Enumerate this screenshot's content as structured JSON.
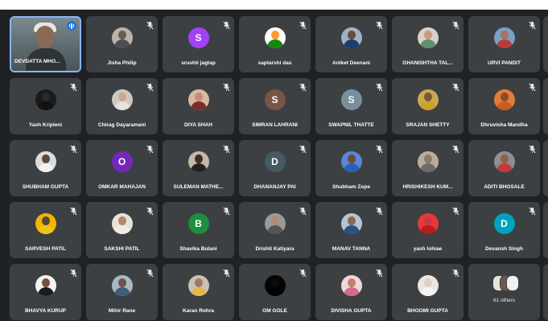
{
  "participants": [
    {
      "name": "DEVDATTA MHO...",
      "type": "self",
      "self": true
    },
    {
      "name": "Jisha Philip",
      "type": "photo",
      "skin": "#6b5a4e",
      "shirt": "#4a4f54",
      "bg": "#b9b4a8"
    },
    {
      "name": "srushti jagtap",
      "type": "initial",
      "initial": "S",
      "color": "#a142f4"
    },
    {
      "name": "saptarshi das",
      "type": "photo",
      "skin": "#ff9933",
      "shirt": "#138808",
      "bg": "#ffffff"
    },
    {
      "name": "Aniket Deenani",
      "type": "photo",
      "skin": "#6b4b3a",
      "shirt": "#1f3b70",
      "bg": "#9fb3c6"
    },
    {
      "name": "GHANISHTHA TAL...",
      "type": "photo",
      "skin": "#c79a7e",
      "shirt": "#5f8f6e",
      "bg": "#d8d2c8"
    },
    {
      "name": "URVI PANDIT",
      "type": "photo",
      "skin": "#a8745a",
      "shirt": "#b93a3a",
      "bg": "#7aa0c8"
    },
    {
      "name": "Yash Kripleni",
      "type": "photo",
      "skin": "#2a2a2a",
      "shirt": "#111111",
      "bg": "#1a1a1a"
    },
    {
      "name": "Chirag Dayaramani",
      "type": "photo",
      "skin": "#c9a990",
      "shirt": "#e6e2dc",
      "bg": "#cfc8be"
    },
    {
      "name": "DIYA SHAH",
      "type": "photo",
      "skin": "#c48e72",
      "shirt": "#7b2d2d",
      "bg": "#d9b9a3"
    },
    {
      "name": "SIMRAN LAHRANI",
      "type": "initial",
      "initial": "S",
      "color": "#795548"
    },
    {
      "name": "SWAPNIL THATTE",
      "type": "initial",
      "initial": "S",
      "color": "#78909c"
    },
    {
      "name": "SRAJAN SHETTY",
      "type": "photo",
      "skin": "#7a5540",
      "shirt": "#c9a227",
      "bg": "#caa84d"
    },
    {
      "name": "Dhruvisha Mandha",
      "type": "photo",
      "skin": "#8a4b2f",
      "shirt": "#c95f1f",
      "bg": "#e07b39"
    },
    {
      "name": "SHUBHAM GUPTA",
      "type": "photo",
      "skin": "#5a4a40",
      "shirt": "#f1f1f1",
      "bg": "#dcdcdc"
    },
    {
      "name": "OMKAR MAHAJAN",
      "type": "initial",
      "initial": "O",
      "color": "#7627bb"
    },
    {
      "name": "SULEMAN MATHE...",
      "type": "photo",
      "skin": "#3b2e28",
      "shirt": "#222222",
      "bg": "#c5b8a5"
    },
    {
      "name": "DHANANJAY PAI",
      "type": "initial",
      "initial": "D",
      "color": "#455a64"
    },
    {
      "name": "Shubham Zope",
      "type": "photo",
      "skin": "#6a4c3a",
      "shirt": "#2f5fb5",
      "bg": "#5a86d6"
    },
    {
      "name": "HRISHIKESH KUM...",
      "type": "photo",
      "skin": "#8c7a6a",
      "shirt": "#6b6b6b",
      "bg": "#b7ad9f"
    },
    {
      "name": "ADITI BHOSALE",
      "type": "photo",
      "skin": "#9a5c45",
      "shirt": "#c23b3b",
      "bg": "#8d8f92"
    },
    {
      "name": "SARVESH PATIL",
      "type": "photo",
      "skin": "#5b4636",
      "shirt": "#f0c419",
      "bg": "#f4b400"
    },
    {
      "name": "SAKSHI PATIL",
      "type": "photo",
      "skin": "#b78569",
      "shirt": "#f0ebe4",
      "bg": "#e8e2d8"
    },
    {
      "name": "Shavika Bulani",
      "type": "initial",
      "initial": "B",
      "color": "#1e8e3e"
    },
    {
      "name": "Drishti Katiyara",
      "type": "photo",
      "skin": "#b48a72",
      "shirt": "#555555",
      "bg": "#9a9a9a"
    },
    {
      "name": "MANAV TANNA",
      "type": "photo",
      "skin": "#8a6a55",
      "shirt": "#2d4f8a",
      "bg": "#b8c4d2"
    },
    {
      "name": "yash lohiae",
      "type": "photo",
      "skin": "#d0344a",
      "shirt": "#b71c1c",
      "bg": "#e53935"
    },
    {
      "name": "Devansh Singh",
      "type": "initial",
      "initial": "D",
      "color": "#00a3bf"
    },
    {
      "name": "BHAVYA KURUP",
      "type": "photo",
      "skin": "#7a4e3c",
      "shirt": "#1b1b1b",
      "bg": "#f3f3f3"
    },
    {
      "name": "Mihir Rane",
      "type": "photo",
      "skin": "#6c5446",
      "shirt": "#3e5e7a",
      "bg": "#aab8c4"
    },
    {
      "name": "Karan Rohra",
      "type": "photo",
      "skin": "#a07a60",
      "shirt": "#e4b84a",
      "bg": "#c9c1b4"
    },
    {
      "name": "OM GOLE",
      "type": "photo",
      "skin": "#0b0b0b",
      "shirt": "#000000",
      "bg": "#050505"
    },
    {
      "name": "DIVISHA GUPTA",
      "type": "photo",
      "skin": "#c08070",
      "shirt": "#d46a8a",
      "bg": "#f0d7dd"
    },
    {
      "name": "BHOOMI GUPTA",
      "type": "photo",
      "skin": "#d9d2cc",
      "shirt": "#f5f5f5",
      "bg": "#ede7e1"
    },
    {
      "name": "61 others",
      "type": "others"
    }
  ],
  "colors": {
    "background": "#202124",
    "tile": "#3c4043",
    "active_border": "#8ab4f8",
    "speaking_indicator": "#1a73e8"
  },
  "icons": {
    "muted": "mic-off-icon",
    "speaking": "audio-level-icon"
  }
}
